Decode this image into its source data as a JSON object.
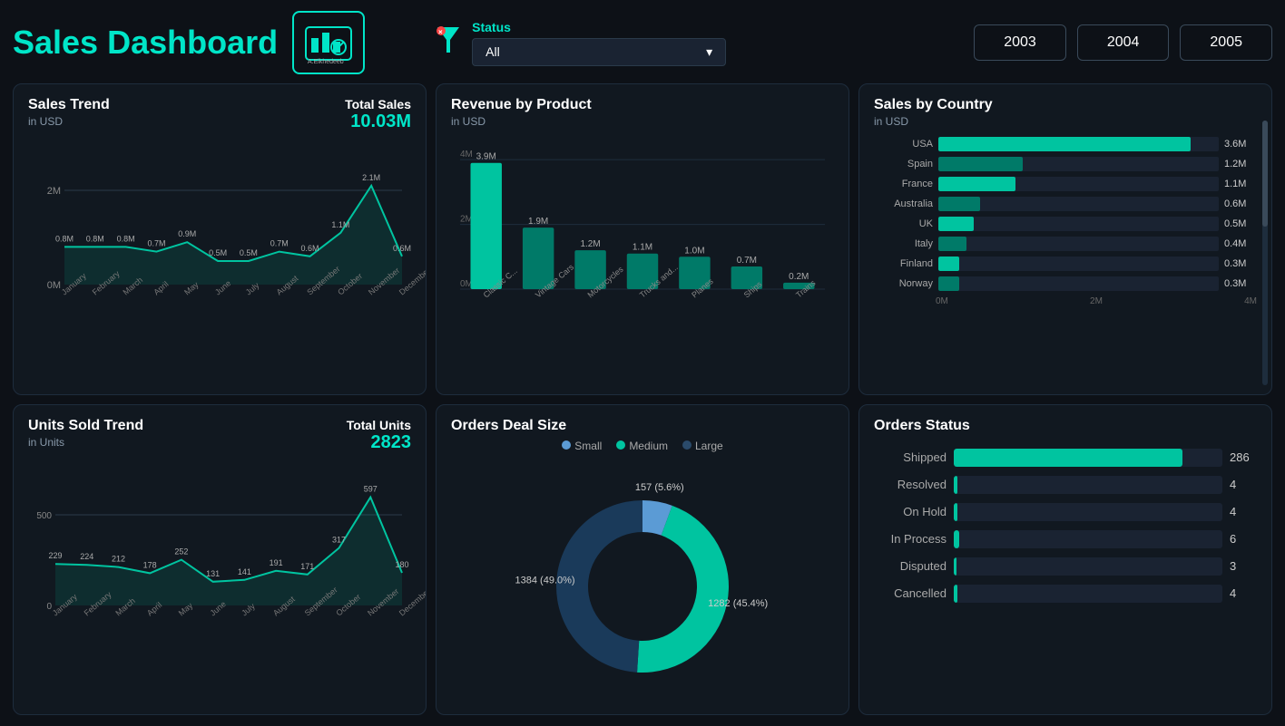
{
  "header": {
    "title": "Sales Dashboard",
    "filter_label": "Status",
    "filter_value": "All",
    "years": [
      "2003",
      "2004",
      "2005"
    ]
  },
  "sales_trend": {
    "title": "Sales Trend",
    "subtitle": "in USD",
    "total_label": "Total Sales",
    "total_value": "10.03M",
    "months": [
      "January",
      "February",
      "March",
      "April",
      "May",
      "June",
      "July",
      "August",
      "September",
      "October",
      "November",
      "December"
    ],
    "values": [
      "0.8M",
      "0.8M",
      "0.8M",
      "0.7M",
      "0.9M",
      "0.5M",
      "0.5M",
      "0.7M",
      "0.6M",
      "1.1M",
      "2.1M",
      "0.6M"
    ],
    "y_axis": [
      "2M",
      "0M"
    ],
    "raw": [
      0.8,
      0.8,
      0.8,
      0.7,
      0.9,
      0.5,
      0.5,
      0.7,
      0.6,
      1.1,
      2.1,
      0.6
    ]
  },
  "revenue_product": {
    "title": "Revenue by Product",
    "subtitle": "in USD",
    "categories": [
      "Classic C...",
      "Vintage Cars",
      "Motorcycles",
      "Trucks and...",
      "Planes",
      "Ships",
      "Trains"
    ],
    "values": [
      3.9,
      1.9,
      1.2,
      1.1,
      1.0,
      0.7,
      0.2
    ],
    "labels": [
      "3.9M",
      "1.9M",
      "1.2M",
      "1.1M",
      "1.0M",
      "0.7M",
      "0.2M"
    ],
    "y_axis": [
      "4M",
      "2M",
      "0M"
    ]
  },
  "sales_country": {
    "title": "Sales by Country",
    "subtitle": "in USD",
    "countries": [
      "USA",
      "Spain",
      "France",
      "Australia",
      "UK",
      "Italy",
      "Finland",
      "Norway"
    ],
    "values": [
      3.6,
      1.2,
      1.1,
      0.6,
      0.5,
      0.4,
      0.3,
      0.3
    ],
    "labels": [
      "3.6M",
      "1.2M",
      "1.1M",
      "0.6M",
      "0.5M",
      "0.4M",
      "0.3M",
      "0.3M"
    ],
    "x_axis": [
      "0M",
      "2M",
      "4M"
    ]
  },
  "units_trend": {
    "title": "Units Sold Trend",
    "subtitle": "in Units",
    "total_label": "Total Units",
    "total_value": "2823",
    "months": [
      "January",
      "February",
      "March",
      "April",
      "May",
      "June",
      "July",
      "August",
      "September",
      "October",
      "November",
      "December"
    ],
    "values": [
      "229",
      "224",
      "212",
      "178",
      "252",
      "131",
      "141",
      "191",
      "171",
      "317",
      "597",
      "180"
    ],
    "raw": [
      229,
      224,
      212,
      178,
      252,
      131,
      141,
      191,
      171,
      317,
      597,
      180
    ],
    "y_axis": [
      "500",
      "0"
    ]
  },
  "orders_deal": {
    "title": "Orders Deal Size",
    "legend": [
      "Small",
      "Medium",
      "Large"
    ],
    "legend_colors": [
      "#5b9bd5",
      "#00c4a0",
      "#2a4a6a"
    ],
    "segments": [
      {
        "label": "157 (5.6%)",
        "value": 5.6,
        "color": "#5b9bd5"
      },
      {
        "label": "1282 (45.4%)",
        "value": 45.4,
        "color": "#00c4a0"
      },
      {
        "label": "1384 (49.0%)",
        "value": 49.0,
        "color": "#1a3a5a"
      }
    ]
  },
  "orders_status": {
    "title": "Orders Status",
    "items": [
      {
        "name": "Shipped",
        "value": 286,
        "max": 286
      },
      {
        "name": "Resolved",
        "value": 4,
        "max": 286
      },
      {
        "name": "On Hold",
        "value": 4,
        "max": 286
      },
      {
        "name": "In Process",
        "value": 6,
        "max": 286
      },
      {
        "name": "Disputed",
        "value": 3,
        "max": 286
      },
      {
        "name": "Cancelled",
        "value": 4,
        "max": 286
      }
    ]
  }
}
